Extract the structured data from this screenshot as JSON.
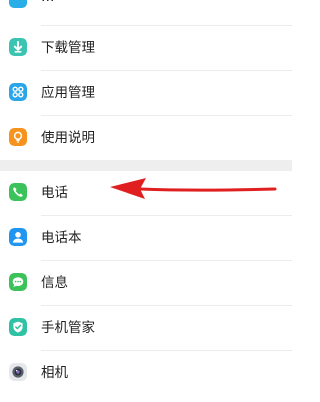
{
  "settings_list": {
    "partial_item": {
      "label": "…",
      "icon": "tool-icon",
      "color": "#2aaee8"
    },
    "section_one": [
      {
        "label": "下载管理",
        "icon": "download-icon",
        "color": "#3ac4b1"
      },
      {
        "label": "应用管理",
        "icon": "apps-grid-icon",
        "color": "#2aa5ea"
      },
      {
        "label": "使用说明",
        "icon": "lightbulb-icon",
        "color": "#f6931e"
      }
    ],
    "section_two": [
      {
        "label": "电话",
        "icon": "phone-icon",
        "color": "#3bc25a"
      },
      {
        "label": "电话本",
        "icon": "contacts-icon",
        "color": "#2096f0"
      },
      {
        "label": "信息",
        "icon": "message-icon",
        "color": "#3bc25a"
      },
      {
        "label": "手机管家",
        "icon": "shield-icon",
        "color": "#2fc2a4"
      },
      {
        "label": "相机",
        "icon": "camera-icon",
        "color": "#5a5f6b"
      }
    ]
  },
  "annotation": {
    "arrow_color": "#e02020",
    "icon": "red-arrow-icon"
  }
}
